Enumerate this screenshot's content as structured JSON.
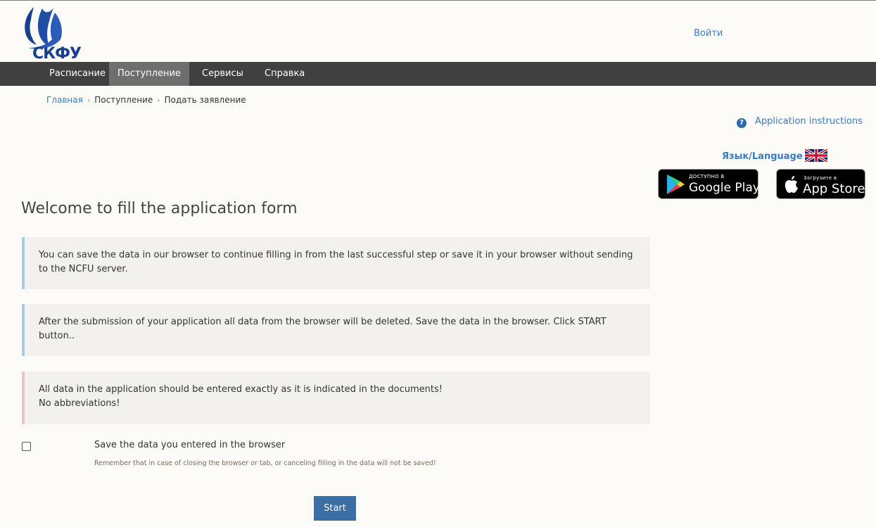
{
  "header": {
    "logo_text": "СКФУ",
    "login_label": "Войти"
  },
  "nav": {
    "items": [
      {
        "label": "Расписание"
      },
      {
        "label": "Поступление"
      },
      {
        "label": "Сервисы"
      },
      {
        "label": "Справка"
      }
    ],
    "active_index": 1
  },
  "breadcrumb": {
    "items": [
      "Главная",
      "Поступление",
      "Подать заявление"
    ]
  },
  "sidebar": {
    "instructions_label": "Application instructions",
    "language_label": "Язык/Language",
    "google_play": {
      "small": "ДОСТУПНО В",
      "big": "Google Play"
    },
    "app_store": {
      "small": "Загрузите в",
      "big": "App Store"
    }
  },
  "main": {
    "title": "Welcome to fill the application form",
    "alerts": [
      {
        "type": "info",
        "text": "You can save the data in our browser to continue filling in from the last successful step or save it in your browser without sending to the NCFU server."
      },
      {
        "type": "info",
        "text": "After the submission of your application all data from the browser will be deleted. Save the data in the browser. Click START button.."
      },
      {
        "type": "danger",
        "line1": "All data in the application should be entered exactly as it is indicated in the documents!",
        "line2": "No abbreviations!"
      }
    ],
    "save_checkbox": {
      "label": "Save the data you entered in the browser",
      "help": "Remember that in case of closing the browser or tab, or canceling filling in the data will not be saved!",
      "checked": false
    },
    "start_label": "Start"
  },
  "colors": {
    "navbar": "#404040",
    "nav_active": "#6e6e6e",
    "link": "#3a7cc4",
    "button": "#3a6ea5",
    "alert_info_border": "#a9cbe3",
    "alert_danger_border": "#eac5c8"
  }
}
